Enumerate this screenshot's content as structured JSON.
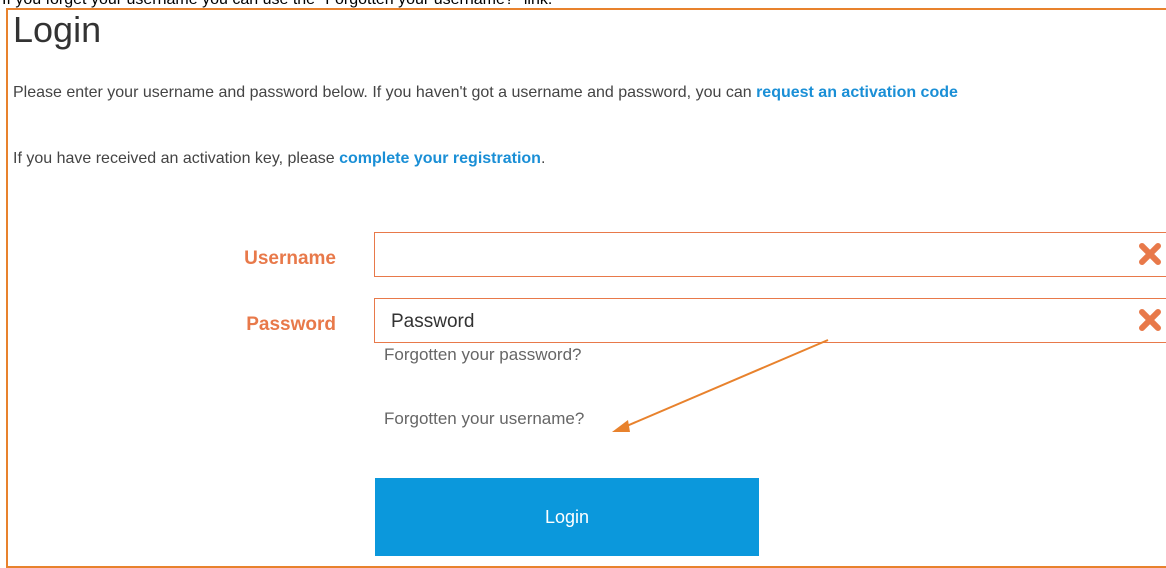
{
  "instruction": "If you forget your username you can use the \"Forgotten your username?\" link.",
  "page": {
    "title": "Login",
    "intro_line1_text": "Please enter your username and password below. If you haven't got a username and password, you can ",
    "intro_line1_link": "request an activation code",
    "intro_line2_text": "If you have received an activation key, please ",
    "intro_line2_link": "complete your registration",
    "intro_line2_end": "."
  },
  "form": {
    "username_label": "Username",
    "username_value": "",
    "password_label": "Password",
    "password_placeholder": "Password",
    "forgot_password_link": "Forgotten your password?",
    "forgot_username_link": "Forgotten your username?",
    "login_button": "Login"
  },
  "colors": {
    "frame_border": "#e8822d",
    "label": "#e8794a",
    "link": "#1a8fd6",
    "button": "#0b98dc",
    "arrow": "#e8822d"
  },
  "icons": {
    "clear": "clear-x-icon",
    "arrow": "annotation-arrow-icon"
  }
}
